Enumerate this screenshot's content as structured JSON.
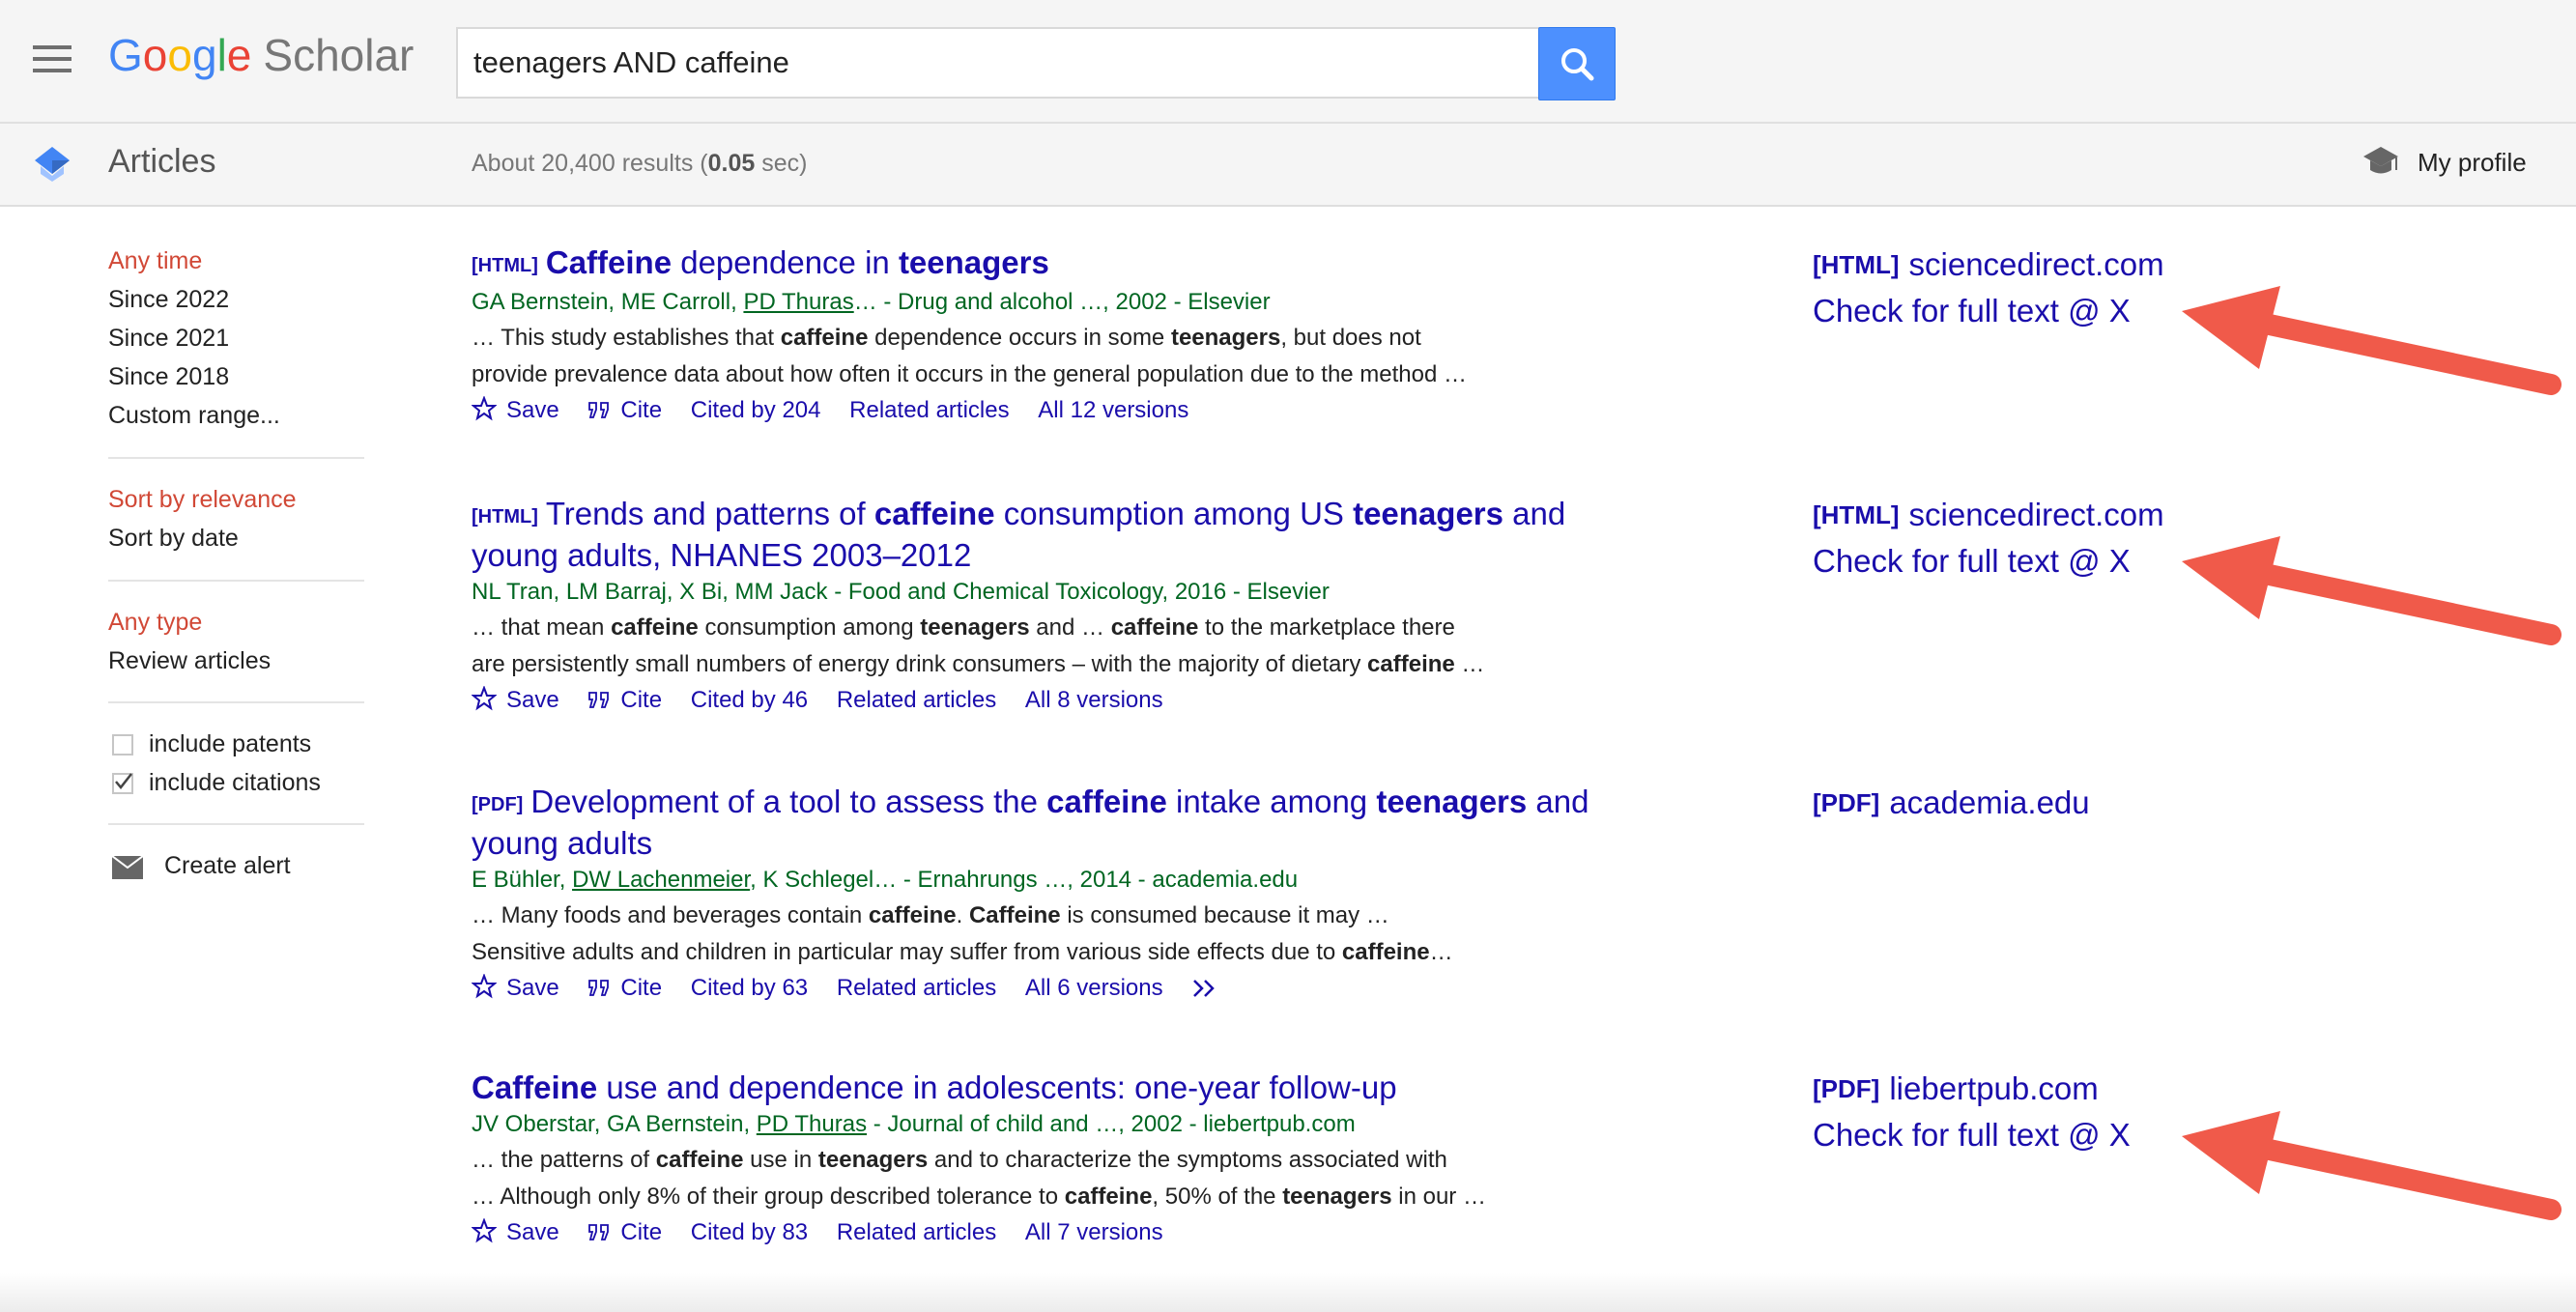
{
  "header": {
    "logo": {
      "g1": "G",
      "o1": "o",
      "o2": "o",
      "g2": "g",
      "l": "l",
      "e": "e",
      "scholar": "Scholar"
    },
    "search": {
      "query": "teenagers AND caffeine"
    },
    "section_label": "Articles",
    "results_prefix": "About 20,400 results (",
    "results_time": "0.05",
    "results_suffix": " sec)",
    "profile_label": "My profile"
  },
  "sidebar": {
    "time": [
      "Any time",
      "Since 2022",
      "Since 2021",
      "Since 2018",
      "Custom range..."
    ],
    "sort": [
      "Sort by relevance",
      "Sort by date"
    ],
    "type": [
      "Any type",
      "Review articles"
    ],
    "checkboxes": [
      {
        "label": "include patents",
        "checked": false
      },
      {
        "label": "include citations",
        "checked": true
      }
    ],
    "create_alert": "Create alert"
  },
  "results": [
    {
      "title_tag": "[HTML]",
      "title_parts": [
        "Caffeine",
        " dependence in ",
        "teenagers"
      ],
      "meta_a": "GA Bernstein, ME Carroll, ",
      "meta_link": "PD Thuras",
      "meta_b": "… - Drug and alcohol …, 2002 - Elsevier",
      "snippet_1": [
        "… This study establishes that ",
        "caffeine",
        " dependence occurs in some ",
        "teenagers",
        ", but does not"
      ],
      "snippet_2": "provide prevalence data about how often it occurs in the general population due to the method …",
      "save": "Save",
      "cite": "Cite",
      "cited_by": "Cited by 204",
      "related": "Related articles",
      "versions": "All 12 versions",
      "side_tag": "[HTML]",
      "side_domain": "sciencedirect.com",
      "side_check": "Check for full text @ X"
    },
    {
      "title_tag": "[HTML]",
      "title_parts": [
        "Trends and patterns of ",
        "caffeine",
        " consumption among US ",
        "teenagers",
        " and"
      ],
      "title_line2": "young adults, NHANES 2003–2012",
      "meta": "NL Tran, LM Barraj, X Bi, MM Jack - Food and Chemical Toxicology, 2016 - Elsevier",
      "snippet_1": [
        "… that mean ",
        "caffeine",
        " consumption among ",
        "teenagers",
        " and … ",
        "caffeine",
        " to the marketplace there"
      ],
      "snippet_2": [
        "are persistently small numbers of energy drink consumers – with the majority of dietary ",
        "caffeine",
        " …"
      ],
      "save": "Save",
      "cite": "Cite",
      "cited_by": "Cited by 46",
      "related": "Related articles",
      "versions": "All 8 versions",
      "side_tag": "[HTML]",
      "side_domain": "sciencedirect.com",
      "side_check": "Check for full text @ X"
    },
    {
      "title_tag": "[PDF]",
      "title_parts": [
        "Development of a tool to assess the ",
        "caffeine",
        " intake among ",
        "teenagers",
        " and"
      ],
      "title_line2": "young adults",
      "meta_a": "E Bühler, ",
      "meta_link": "DW Lachenmeier",
      "meta_b": ", K Schlegel… - Ernahrungs …, 2014 - academia.edu",
      "snippet_1": [
        "… Many foods and beverages contain ",
        "caffeine",
        ". ",
        "Caffeine",
        " is consumed because it may …"
      ],
      "snippet_2": [
        "Sensitive adults and children in particular may suffer from various side effects due to ",
        "caffeine",
        "…"
      ],
      "save": "Save",
      "cite": "Cite",
      "cited_by": "Cited by 63",
      "related": "Related articles",
      "versions": "All 6 versions",
      "side_tag": "[PDF]",
      "side_domain": "academia.edu"
    },
    {
      "title_parts": [
        "Caffeine",
        " use and dependence in adolescents: one-year follow-up"
      ],
      "meta_a": "JV Oberstar, GA Bernstein, ",
      "meta_link": "PD Thuras",
      "meta_b": " - Journal of child and …, 2002 - liebertpub.com",
      "snippet_1": [
        "… the patterns of ",
        "caffeine",
        " use in ",
        "teenagers",
        " and to characterize the symptoms associated with"
      ],
      "snippet_2": [
        "… Although only 8% of their group described tolerance to ",
        "caffeine",
        ", 50% of the ",
        "teenagers",
        " in our …"
      ],
      "save": "Save",
      "cite": "Cite",
      "cited_by": "Cited by 83",
      "related": "Related articles",
      "versions": "All 7 versions",
      "side_tag": "[PDF]",
      "side_domain": "liebertpub.com",
      "side_check": "Check for full text @ X"
    }
  ],
  "colors": {
    "link": "#1a0dab",
    "meta_green": "#006621",
    "active_red": "#d14836",
    "search_blue": "#4d90fe",
    "annotation_arrow": "#f05a4a"
  },
  "icons": [
    "hamburger-icon",
    "search-icon",
    "scholar-cap-icon",
    "my-profile-icon",
    "envelope-icon",
    "star-icon",
    "quote-icon",
    "double-chevron-icon",
    "arrow-annotation"
  ]
}
